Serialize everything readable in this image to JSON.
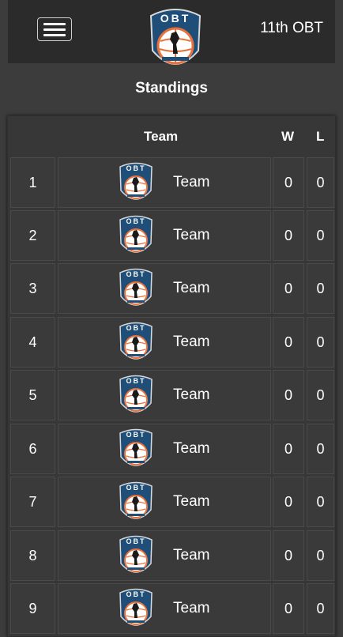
{
  "header": {
    "title": "11th OBT",
    "logo_text": "OBT"
  },
  "page": {
    "title": "Standings"
  },
  "table": {
    "columns": {
      "team": "Team",
      "wins": "W",
      "losses": "L"
    },
    "rows": [
      {
        "rank": "1",
        "team": "Team",
        "w": "0",
        "l": "0"
      },
      {
        "rank": "2",
        "team": "Team",
        "w": "0",
        "l": "0"
      },
      {
        "rank": "3",
        "team": "Team",
        "w": "0",
        "l": "0"
      },
      {
        "rank": "4",
        "team": "Team",
        "w": "0",
        "l": "0"
      },
      {
        "rank": "5",
        "team": "Team",
        "w": "0",
        "l": "0"
      },
      {
        "rank": "6",
        "team": "Team",
        "w": "0",
        "l": "0"
      },
      {
        "rank": "7",
        "team": "Team",
        "w": "0",
        "l": "0"
      },
      {
        "rank": "8",
        "team": "Team",
        "w": "0",
        "l": "0"
      },
      {
        "rank": "9",
        "team": "Team",
        "w": "0",
        "l": "0"
      }
    ]
  },
  "colors": {
    "background": "#3c3c3c",
    "header": "#2b2b2b",
    "logo_blue": "#1f4e79",
    "logo_orange": "#e8703a"
  }
}
